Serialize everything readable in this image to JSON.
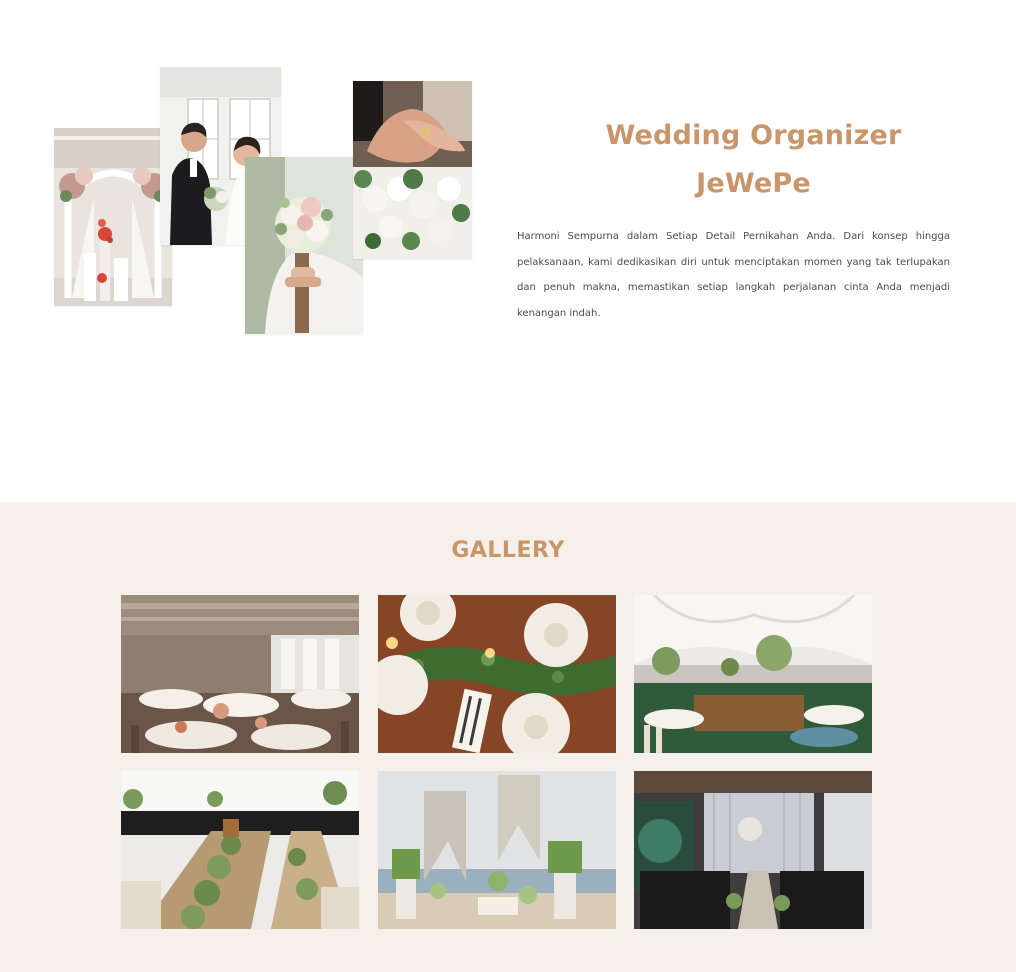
{
  "about": {
    "title": "Wedding Organizer JeWePe",
    "description": "Harmoni Sempurna dalam Setiap Detail Pernikahan Anda. Dari konsep hingga pelaksanaan, kami dedikasikan diri untuk menciptakan momen yang tak terlupakan dan penuh makna, memastikan setiap langkah perjalanan cinta Anda menjadi kenangan indah.",
    "collage": [
      "wedding-arch-photo",
      "bride-groom-photo",
      "bridal-bouquet-photo",
      "ring-hands-photo"
    ]
  },
  "gallery": {
    "title": "GALLERY",
    "images": [
      "banquet-hall-photo",
      "table-setting-photo",
      "tent-venue-photo",
      "long-table-photo",
      "outdoor-ceremony-photo",
      "chapel-aisle-photo"
    ]
  },
  "colors": {
    "accent": "#c9956b",
    "gallery_background": "#f5f0ea",
    "text": "#4a4a4a"
  }
}
